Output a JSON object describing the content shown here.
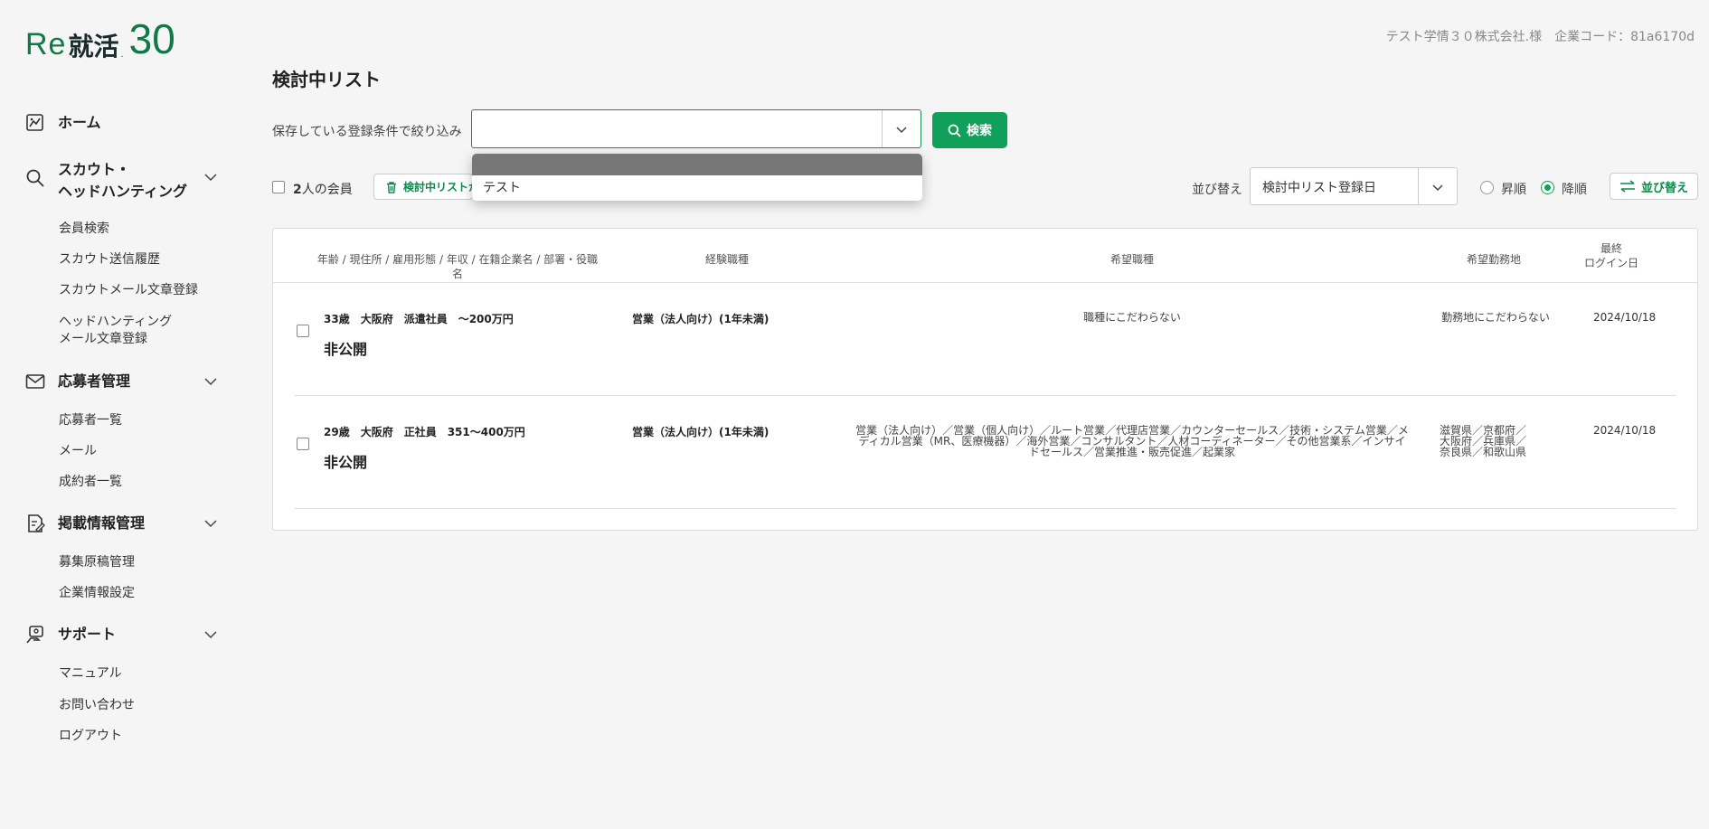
{
  "brand": {
    "logo_re": "Re",
    "logo_kj": "就活",
    "logo_dot": ".",
    "logo_num": "30"
  },
  "header": {
    "company": "テスト学情３０株式会社.様　企業コード：81a6170d"
  },
  "sidebar": {
    "home": "ホーム",
    "scout": {
      "label_line1": "スカウト・",
      "label_line2": "ヘッドハンティング",
      "items": [
        "会員検索",
        "スカウト送信履歴",
        "スカウトメール文章登録",
        "ヘッドハンティングメール文章登録"
      ]
    },
    "applicants": {
      "label": "応募者管理",
      "items": [
        "応募者一覧",
        "メール",
        "成約者一覧"
      ]
    },
    "listing": {
      "label": "掲載情報管理",
      "items": [
        "募集原稿管理",
        "企業情報設定"
      ]
    },
    "support": {
      "label": "サポート",
      "items": [
        "マニュアル",
        "お問い合わせ",
        "ログアウト"
      ]
    }
  },
  "main": {
    "title": "検討中リスト",
    "filter_label": "保存している登録条件で絞り込み",
    "filter_value": "",
    "search_button": "検索",
    "dropdown_options": [
      "",
      "テスト"
    ],
    "members_count": "2",
    "members_suffix": "人の会員",
    "remove_button": "検討中リストから削除",
    "sort_label": "並び替え",
    "sort_value": "検討中リスト登録日",
    "asc_label": "昇順",
    "desc_label": "降順",
    "sort_order": "desc",
    "sort_button": "並び替え"
  },
  "table": {
    "headers": {
      "profile": "年齢 / 現住所 / 雇用形態 / 年収 / 在籍企業名 / 部署・役職名",
      "experience": "経験職種",
      "desired_job": "希望職種",
      "desired_location": "希望勤務地",
      "last_login_1": "最終",
      "last_login_2": "ログイン日"
    },
    "rows": [
      {
        "summary": "33歳　大阪府　派遣社員　～200万円",
        "name": "非公開",
        "experience": "営業（法人向け）(1年未満)",
        "desired_job": "職種にこだわらない",
        "desired_location": "勤務地にこだわらない",
        "last_login": "2024/10/18"
      },
      {
        "summary": "29歳　大阪府　正社員　351～400万円",
        "name": "非公開",
        "experience": "営業（法人向け）(1年未満)",
        "desired_job": "営業（法人向け）／営業（個人向け）／ルート営業／代理店営業／カウンターセールス／技術・システム営業／メディカル営業（MR、医療機器）／海外営業／コンサルタント／人材コーディネーター／その他営業系／インサイドセールス／営業推進・販売促進／起業家",
        "desired_location": "滋賀県／京都府／大阪府／兵庫県／奈良県／和歌山県",
        "last_login": "2024/10/18"
      }
    ]
  },
  "colors": {
    "accent": "#10a05a",
    "brand_green": "#0f7a45"
  }
}
